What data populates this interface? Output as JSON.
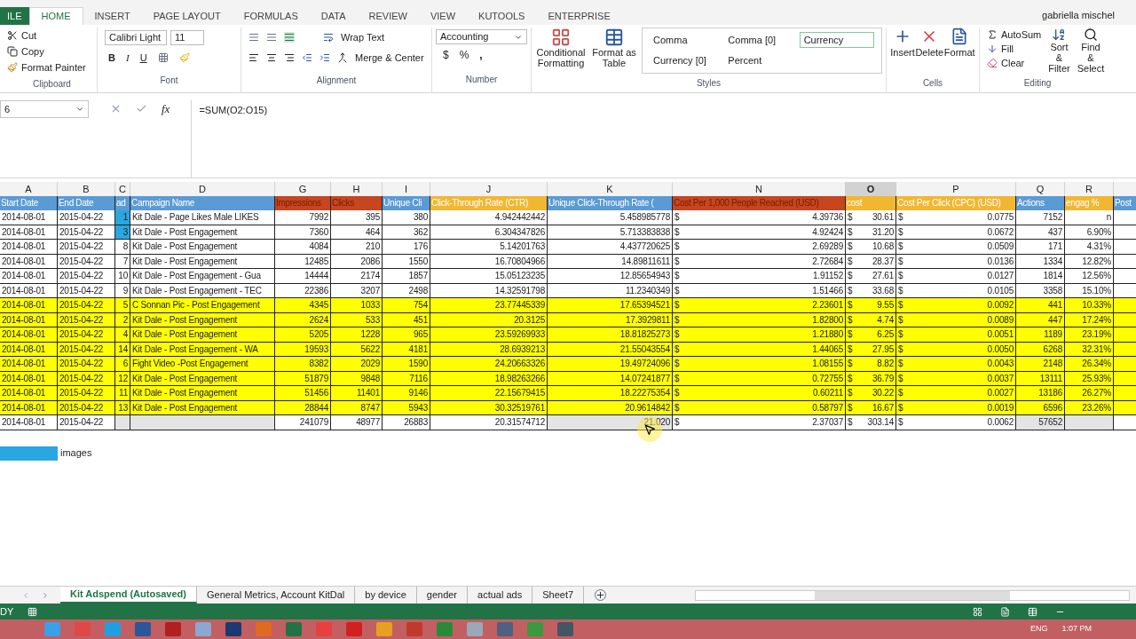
{
  "ribbon_tabs": [
    {
      "label": "ILE",
      "kind": "file",
      "selected": false
    },
    {
      "label": "HOME",
      "kind": "tab",
      "selected": true
    },
    {
      "label": "INSERT",
      "kind": "tab",
      "selected": false
    },
    {
      "label": "PAGE LAYOUT",
      "kind": "tab",
      "selected": false
    },
    {
      "label": "FORMULAS",
      "kind": "tab",
      "selected": false
    },
    {
      "label": "DATA",
      "kind": "tab",
      "selected": false
    },
    {
      "label": "REVIEW",
      "kind": "tab",
      "selected": false
    },
    {
      "label": "VIEW",
      "kind": "tab",
      "selected": false
    },
    {
      "label": "KUTOOLS",
      "kind": "tab",
      "selected": false
    },
    {
      "label": "ENTERPRISE",
      "kind": "tab",
      "selected": false
    }
  ],
  "user": "gabriella mischel",
  "clipboard": {
    "cut": "Cut",
    "copy": "Copy",
    "format_painter": "Format Painter",
    "label": "Clipboard"
  },
  "font": {
    "name": "Calibri Light",
    "size": "11",
    "bold": "B",
    "italic": "I",
    "underline": "U",
    "label": "Font"
  },
  "alignment": {
    "wrap": "Wrap Text",
    "merge": "Merge & Center",
    "label": "Alignment"
  },
  "number": {
    "format": "Accounting",
    "currency": "$",
    "percent": "%",
    "comma": ",",
    "label": "Number"
  },
  "styles": {
    "conditional": [
      "Conditional",
      "Formatting"
    ],
    "format_table": [
      "Format as",
      "Table"
    ],
    "cells": [
      {
        "label": "Comma",
        "selected": false
      },
      {
        "label": "Comma [0]",
        "selected": false
      },
      {
        "label": "Currency",
        "selected": true
      },
      {
        "label": "Currency [0]",
        "selected": false
      },
      {
        "label": "Percent",
        "selected": false
      }
    ],
    "label": "Styles"
  },
  "cells_group": {
    "buttons": [
      "Insert",
      "Delete",
      "Format"
    ],
    "label": "Cells"
  },
  "editing": {
    "autosum": "AutoSum",
    "fill": "Fill",
    "clear": "Clear",
    "sort": [
      "Sort &",
      "Filter"
    ],
    "find": [
      "Find &",
      "Select"
    ],
    "label": "Editing"
  },
  "formula_bar": {
    "name_box": "6",
    "fx": "fx",
    "formula": "=SUM(O2:O15)"
  },
  "columns": [
    {
      "letter": "A",
      "header": "Start Date",
      "color": "#5b9bd5",
      "selected": false
    },
    {
      "letter": "B",
      "header": "End Date",
      "color": "#5b9bd5",
      "selected": false
    },
    {
      "letter": "C",
      "header": "ad",
      "color": "#5b9bd5",
      "selected": false
    },
    {
      "letter": "D",
      "header": "Campaign Name",
      "color": "#5b9bd5",
      "selected": false
    },
    {
      "letter": "G",
      "header": "Impressions",
      "color": "#c5461f",
      "selected": false
    },
    {
      "letter": "H",
      "header": "Clicks",
      "color": "#c5461f",
      "selected": false
    },
    {
      "letter": "I",
      "header": "Unique Cli",
      "color": "#5b9bd5",
      "selected": false
    },
    {
      "letter": "J",
      "header": "Click-Through Rate (CTR)",
      "color": "#f2b731",
      "selected": false
    },
    {
      "letter": "K",
      "header": "Unique Click-Through Rate (",
      "color": "#5b9bd5",
      "selected": false
    },
    {
      "letter": "N",
      "header": "Cost Per 1,000 People Reached (USD)",
      "color": "#c5461f",
      "selected": false
    },
    {
      "letter": "O",
      "header": "cost",
      "color": "#f2b731",
      "selected": true
    },
    {
      "letter": "P",
      "header": "Cost Per Click (CPC) (USD)",
      "color": "#f2b731",
      "selected": false
    },
    {
      "letter": "Q",
      "header": "Actions",
      "color": "#5b9bd5",
      "selected": false
    },
    {
      "letter": "R",
      "header": "engag %",
      "color": "#f2b731",
      "selected": false
    },
    {
      "header": "Post",
      "color": "#5b9bd5",
      "selected": false
    }
  ],
  "rows": [
    {
      "kind": "data",
      "highlighted": false,
      "ad_marked": true,
      "cells": [
        "2014-08-01",
        "2015-04-22",
        "1",
        "Kit Dale - Page Likes Male LIKES",
        "7992",
        "395",
        "380",
        "4.942442442",
        "5.458985778",
        {
          "symbol": "$",
          "value": "4.39736"
        },
        {
          "symbol": "$",
          "value": "30.61"
        },
        {
          "symbol": "$",
          "value": "0.0775"
        },
        "7152",
        "n",
        ""
      ]
    },
    {
      "kind": "data",
      "highlighted": false,
      "ad_marked": true,
      "cells": [
        "2014-08-01",
        "2015-04-22",
        "3",
        "Kit Dale - Post Engagement",
        "7360",
        "464",
        "362",
        "6.304347826",
        "5.713383838",
        {
          "symbol": "$",
          "value": "4.92424"
        },
        {
          "symbol": "$",
          "value": "31.20"
        },
        {
          "symbol": "$",
          "value": "0.0672"
        },
        "437",
        "6.90%",
        ""
      ]
    },
    {
      "kind": "data",
      "highlighted": false,
      "ad_marked": false,
      "cells": [
        "2014-08-01",
        "2015-04-22",
        "8",
        "Kit Dale - Post Engagement",
        "4084",
        "210",
        "176",
        "5.14201763",
        "4.437720625",
        {
          "symbol": "$",
          "value": "2.69289"
        },
        {
          "symbol": "$",
          "value": "10.68"
        },
        {
          "symbol": "$",
          "value": "0.0509"
        },
        "171",
        "4.31%",
        ""
      ]
    },
    {
      "kind": "data",
      "highlighted": false,
      "ad_marked": false,
      "cells": [
        "2014-08-01",
        "2015-04-22",
        "7",
        "Kit Dale - Post Engagement",
        "12485",
        "2086",
        "1550",
        "16.70804966",
        "14.89811611",
        {
          "symbol": "$",
          "value": "2.72684"
        },
        {
          "symbol": "$",
          "value": "28.37"
        },
        {
          "symbol": "$",
          "value": "0.0136"
        },
        "1334",
        "12.82%",
        ""
      ]
    },
    {
      "kind": "data",
      "highlighted": false,
      "ad_marked": false,
      "cells": [
        "2014-08-01",
        "2015-04-22",
        "10",
        "Kit Dale - Post Engagement - Gua",
        "14444",
        "2174",
        "1857",
        "15.05123235",
        "12.85654943",
        {
          "symbol": "$",
          "value": "1.91152"
        },
        {
          "symbol": "$",
          "value": "27.61"
        },
        {
          "symbol": "$",
          "value": "0.0127"
        },
        "1814",
        "12.56%",
        ""
      ]
    },
    {
      "kind": "data",
      "highlighted": false,
      "ad_marked": false,
      "cells": [
        "2014-08-01",
        "2015-04-22",
        "9",
        "Kit Dale - Post Engagement - TEC",
        "22386",
        "3207",
        "2498",
        "14.32591798",
        "11.2340349",
        {
          "symbol": "$",
          "value": "1.51466"
        },
        {
          "symbol": "$",
          "value": "33.68"
        },
        {
          "symbol": "$",
          "value": "0.0105"
        },
        "3358",
        "15.10%",
        ""
      ]
    },
    {
      "kind": "data",
      "highlighted": true,
      "ad_marked": false,
      "cells": [
        "2014-08-01",
        "2015-04-22",
        "5",
        "C Sonnan Pic - Post Engagement",
        "4345",
        "1033",
        "754",
        "23.77445339",
        "17.65394521",
        {
          "symbol": "$",
          "value": "2.23601"
        },
        {
          "symbol": "$",
          "value": "9.55"
        },
        {
          "symbol": "$",
          "value": "0.0092"
        },
        "441",
        "10.33%",
        ""
      ]
    },
    {
      "kind": "data",
      "highlighted": true,
      "ad_marked": false,
      "cells": [
        "2014-08-01",
        "2015-04-22",
        "2",
        "Kit Dale - Post Engagement",
        "2624",
        "533",
        "451",
        "20.3125",
        "17.3929811",
        {
          "symbol": "$",
          "value": "1.82800"
        },
        {
          "symbol": "$",
          "value": "4.74"
        },
        {
          "symbol": "$",
          "value": "0.0089"
        },
        "447",
        "17.24%",
        ""
      ]
    },
    {
      "kind": "data",
      "highlighted": true,
      "ad_marked": false,
      "cells": [
        "2014-08-01",
        "2015-04-22",
        "4",
        "Kit Dale - Post Engagement",
        "5205",
        "1228",
        "965",
        "23.59269933",
        "18.81825273",
        {
          "symbol": "$",
          "value": "1.21880"
        },
        {
          "symbol": "$",
          "value": "6.25"
        },
        {
          "symbol": "$",
          "value": "0.0051"
        },
        "1189",
        "23.19%",
        ""
      ]
    },
    {
      "kind": "data",
      "highlighted": true,
      "ad_marked": false,
      "cells": [
        "2014-08-01",
        "2015-04-22",
        "14",
        "Kit Dale - Post Engagement - WA",
        "19593",
        "5622",
        "4181",
        "28.6939213",
        "21.55043554",
        {
          "symbol": "$",
          "value": "1.44065"
        },
        {
          "symbol": "$",
          "value": "27.95"
        },
        {
          "symbol": "$",
          "value": "0.0050"
        },
        "6268",
        "32.31%",
        ""
      ]
    },
    {
      "kind": "data",
      "highlighted": true,
      "ad_marked": false,
      "cells": [
        "2014-08-01",
        "2015-04-22",
        "6",
        "Fight Video -Post Engagement",
        "8382",
        "2029",
        "1590",
        "24.20663326",
        "19.49724096",
        {
          "symbol": "$",
          "value": "1.08155"
        },
        {
          "symbol": "$",
          "value": "8.82"
        },
        {
          "symbol": "$",
          "value": "0.0043"
        },
        "2148",
        "26.34%",
        ""
      ]
    },
    {
      "kind": "data",
      "highlighted": true,
      "ad_marked": false,
      "cells": [
        "2014-08-01",
        "2015-04-22",
        "12",
        "Kit Dale - Post Engagement",
        "51879",
        "9848",
        "7116",
        "18.98263266",
        "14.07241877",
        {
          "symbol": "$",
          "value": "0.72755"
        },
        {
          "symbol": "$",
          "value": "36.79"
        },
        {
          "symbol": "$",
          "value": "0.0037"
        },
        "13111",
        "25.93%",
        ""
      ]
    },
    {
      "kind": "data",
      "highlighted": true,
      "ad_marked": false,
      "cells": [
        "2014-08-01",
        "2015-04-22",
        "11",
        "Kit Dale - Post Engagement",
        "51456",
        "11401",
        "9146",
        "22.15679415",
        "18.22275354",
        {
          "symbol": "$",
          "value": "0.60211"
        },
        {
          "symbol": "$",
          "value": "30.22"
        },
        {
          "symbol": "$",
          "value": "0.0027"
        },
        "13186",
        "26.27%",
        ""
      ]
    },
    {
      "kind": "data",
      "highlighted": true,
      "ad_marked": false,
      "cells": [
        "2014-08-01",
        "2015-04-22",
        "13",
        "Kit Dale - Post Engagement",
        "28844",
        "8747",
        "5943",
        "30.32519761",
        "20.9614842",
        {
          "symbol": "$",
          "value": "0.58797"
        },
        {
          "symbol": "$",
          "value": "16.67"
        },
        {
          "symbol": "$",
          "value": "0.0019"
        },
        "6596",
        "23.26%",
        ""
      ]
    },
    {
      "kind": "total",
      "highlighted": false,
      "ad_marked": false,
      "cells": [
        "2014-08-01",
        "2015-04-22",
        "",
        "",
        "241079",
        "48977",
        "26883",
        "20.31574712",
        "21.020",
        {
          "symbol": "$",
          "value": "2.37037"
        },
        {
          "symbol": "$",
          "value": "303.14"
        },
        {
          "symbol": "$",
          "value": "0.0062"
        },
        "57652",
        "",
        ""
      ]
    }
  ],
  "legend": {
    "color": "#2aa6e0",
    "label": "images"
  },
  "sheet_tabs": [
    {
      "label": "Kit Adspend (Autosaved)",
      "selected": true
    },
    {
      "label": "General Metrics, Account KitDal",
      "selected": false
    },
    {
      "label": "by device",
      "selected": false
    },
    {
      "label": "gender",
      "selected": false
    },
    {
      "label": "actual ads",
      "selected": false
    },
    {
      "label": "Sheet7",
      "selected": false
    }
  ],
  "status": "DY",
  "clock": "1:07 PM",
  "language": "ENG"
}
